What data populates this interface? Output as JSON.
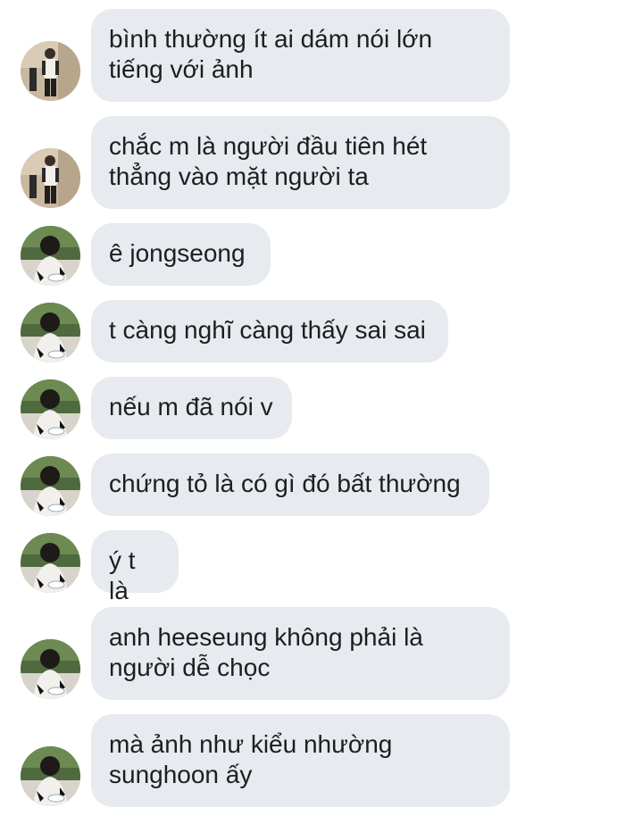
{
  "messages": [
    {
      "text": "bình thường ít ai dám nói lớn\ntiếng với ảnh",
      "sender": "a"
    },
    {
      "text": "chắc m là người đầu tiên hét\nthẳng vào mặt người ta",
      "sender": "a"
    },
    {
      "text": "ê jongseong",
      "sender": "b"
    },
    {
      "text": "t càng nghĩ càng thấy sai sai",
      "sender": "b"
    },
    {
      "text": "nếu m đã nói v",
      "sender": "b"
    },
    {
      "text": "chứng tỏ là có gì đó bất thường",
      "sender": "b"
    },
    {
      "text": "ý t là",
      "sender": "b"
    },
    {
      "text": "anh heeseung không phải là\nngười dễ chọc",
      "sender": "b"
    },
    {
      "text": "mà ảnh như kiểu nhường\nsunghoon ấy",
      "sender": "b"
    }
  ],
  "colors": {
    "bubble": "#e7eaee",
    "text": "#1c1e21",
    "background": "#ffffff"
  }
}
